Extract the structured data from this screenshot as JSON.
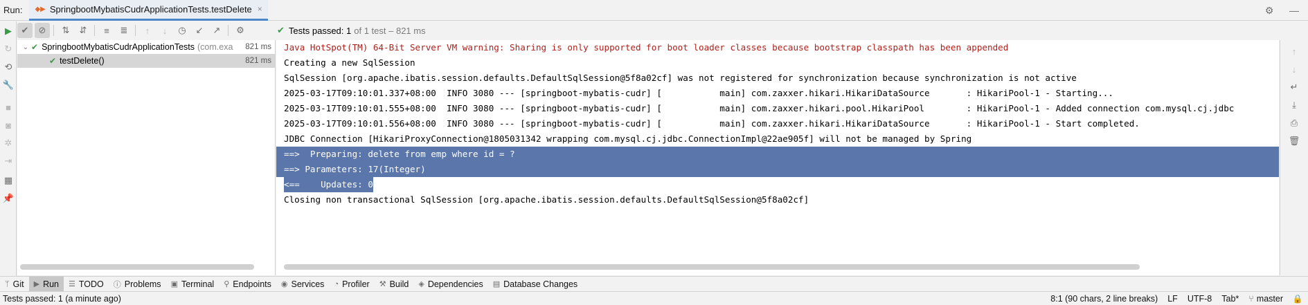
{
  "run_header": {
    "label": "Run:",
    "tab_title": "SpringbootMybatisCudrApplicationTests.testDelete",
    "tab_close": "×"
  },
  "test_status": {
    "text": "Tests passed:",
    "count": "1",
    "detail": "of 1 test – 821 ms"
  },
  "tree": {
    "root": {
      "name": "SpringbootMybatisCudrApplicationTests",
      "pkg": "(com.exa",
      "time": "821 ms"
    },
    "child": {
      "name": "testDelete()",
      "time": "821 ms"
    }
  },
  "console": {
    "lines": [
      "Java HotSpot(TM) 64-Bit Server VM warning: Sharing is only supported for boot loader classes because bootstrap classpath has been appended",
      "Creating a new SqlSession",
      "SqlSession [org.apache.ibatis.session.defaults.DefaultSqlSession@5f8a02cf] was not registered for synchronization because synchronization is not active",
      "2025-03-17T09:10:01.337+08:00  INFO 3080 --- [springboot-mybatis-cudr] [           main] com.zaxxer.hikari.HikariDataSource       : HikariPool-1 - Starting...",
      "2025-03-17T09:10:01.555+08:00  INFO 3080 --- [springboot-mybatis-cudr] [           main] com.zaxxer.hikari.pool.HikariPool        : HikariPool-1 - Added connection com.mysql.cj.jdbc",
      "2025-03-17T09:10:01.556+08:00  INFO 3080 --- [springboot-mybatis-cudr] [           main] com.zaxxer.hikari.HikariDataSource       : HikariPool-1 - Start completed.",
      "JDBC Connection [HikariProxyConnection@1805031342 wrapping com.mysql.cj.jdbc.ConnectionImpl@22ae905f] will not be managed by Spring",
      "==>  Preparing: delete from emp where id = ?",
      "==> Parameters: 17(Integer)",
      "<==    Updates: 0",
      "Closing non transactional SqlSession [org.apache.ibatis.session.defaults.DefaultSqlSession@5f8a02cf]"
    ]
  },
  "tool_windows": [
    {
      "label": "Git",
      "icon": "git-icon"
    },
    {
      "label": "Run",
      "icon": "run-icon",
      "active": true
    },
    {
      "label": "TODO",
      "icon": "todo-icon"
    },
    {
      "label": "Problems",
      "icon": "problems-icon"
    },
    {
      "label": "Terminal",
      "icon": "terminal-icon"
    },
    {
      "label": "Endpoints",
      "icon": "endpoints-icon"
    },
    {
      "label": "Services",
      "icon": "services-icon"
    },
    {
      "label": "Profiler",
      "icon": "profiler-icon"
    },
    {
      "label": "Build",
      "icon": "build-icon"
    },
    {
      "label": "Dependencies",
      "icon": "dependencies-icon"
    },
    {
      "label": "Database Changes",
      "icon": "database-changes-icon"
    }
  ],
  "status_bar": {
    "message": "Tests passed: 1 (a minute ago)",
    "position": "8:1 (90 chars, 2 line breaks)",
    "line_sep": "LF",
    "encoding": "UTF-8",
    "indent": "Tab*",
    "branch": "master"
  },
  "colors": {
    "accent": "#4a88c7",
    "success": "#3a9b48",
    "warning_text": "#b0201a",
    "selection": "#5a76aa"
  }
}
